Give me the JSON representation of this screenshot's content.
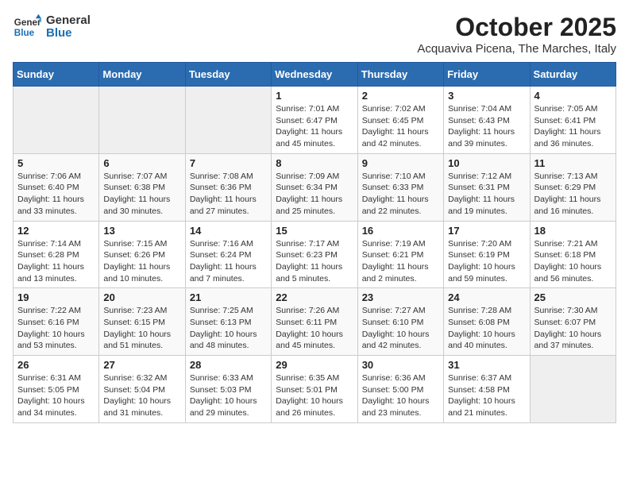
{
  "header": {
    "logo_general": "General",
    "logo_blue": "Blue",
    "month_title": "October 2025",
    "subtitle": "Acquaviva Picena, The Marches, Italy"
  },
  "days_of_week": [
    "Sunday",
    "Monday",
    "Tuesday",
    "Wednesday",
    "Thursday",
    "Friday",
    "Saturday"
  ],
  "weeks": [
    [
      {
        "day": "",
        "info": ""
      },
      {
        "day": "",
        "info": ""
      },
      {
        "day": "",
        "info": ""
      },
      {
        "day": "1",
        "info": "Sunrise: 7:01 AM\nSunset: 6:47 PM\nDaylight: 11 hours and 45 minutes."
      },
      {
        "day": "2",
        "info": "Sunrise: 7:02 AM\nSunset: 6:45 PM\nDaylight: 11 hours and 42 minutes."
      },
      {
        "day": "3",
        "info": "Sunrise: 7:04 AM\nSunset: 6:43 PM\nDaylight: 11 hours and 39 minutes."
      },
      {
        "day": "4",
        "info": "Sunrise: 7:05 AM\nSunset: 6:41 PM\nDaylight: 11 hours and 36 minutes."
      }
    ],
    [
      {
        "day": "5",
        "info": "Sunrise: 7:06 AM\nSunset: 6:40 PM\nDaylight: 11 hours and 33 minutes."
      },
      {
        "day": "6",
        "info": "Sunrise: 7:07 AM\nSunset: 6:38 PM\nDaylight: 11 hours and 30 minutes."
      },
      {
        "day": "7",
        "info": "Sunrise: 7:08 AM\nSunset: 6:36 PM\nDaylight: 11 hours and 27 minutes."
      },
      {
        "day": "8",
        "info": "Sunrise: 7:09 AM\nSunset: 6:34 PM\nDaylight: 11 hours and 25 minutes."
      },
      {
        "day": "9",
        "info": "Sunrise: 7:10 AM\nSunset: 6:33 PM\nDaylight: 11 hours and 22 minutes."
      },
      {
        "day": "10",
        "info": "Sunrise: 7:12 AM\nSunset: 6:31 PM\nDaylight: 11 hours and 19 minutes."
      },
      {
        "day": "11",
        "info": "Sunrise: 7:13 AM\nSunset: 6:29 PM\nDaylight: 11 hours and 16 minutes."
      }
    ],
    [
      {
        "day": "12",
        "info": "Sunrise: 7:14 AM\nSunset: 6:28 PM\nDaylight: 11 hours and 13 minutes."
      },
      {
        "day": "13",
        "info": "Sunrise: 7:15 AM\nSunset: 6:26 PM\nDaylight: 11 hours and 10 minutes."
      },
      {
        "day": "14",
        "info": "Sunrise: 7:16 AM\nSunset: 6:24 PM\nDaylight: 11 hours and 7 minutes."
      },
      {
        "day": "15",
        "info": "Sunrise: 7:17 AM\nSunset: 6:23 PM\nDaylight: 11 hours and 5 minutes."
      },
      {
        "day": "16",
        "info": "Sunrise: 7:19 AM\nSunset: 6:21 PM\nDaylight: 11 hours and 2 minutes."
      },
      {
        "day": "17",
        "info": "Sunrise: 7:20 AM\nSunset: 6:19 PM\nDaylight: 10 hours and 59 minutes."
      },
      {
        "day": "18",
        "info": "Sunrise: 7:21 AM\nSunset: 6:18 PM\nDaylight: 10 hours and 56 minutes."
      }
    ],
    [
      {
        "day": "19",
        "info": "Sunrise: 7:22 AM\nSunset: 6:16 PM\nDaylight: 10 hours and 53 minutes."
      },
      {
        "day": "20",
        "info": "Sunrise: 7:23 AM\nSunset: 6:15 PM\nDaylight: 10 hours and 51 minutes."
      },
      {
        "day": "21",
        "info": "Sunrise: 7:25 AM\nSunset: 6:13 PM\nDaylight: 10 hours and 48 minutes."
      },
      {
        "day": "22",
        "info": "Sunrise: 7:26 AM\nSunset: 6:11 PM\nDaylight: 10 hours and 45 minutes."
      },
      {
        "day": "23",
        "info": "Sunrise: 7:27 AM\nSunset: 6:10 PM\nDaylight: 10 hours and 42 minutes."
      },
      {
        "day": "24",
        "info": "Sunrise: 7:28 AM\nSunset: 6:08 PM\nDaylight: 10 hours and 40 minutes."
      },
      {
        "day": "25",
        "info": "Sunrise: 7:30 AM\nSunset: 6:07 PM\nDaylight: 10 hours and 37 minutes."
      }
    ],
    [
      {
        "day": "26",
        "info": "Sunrise: 6:31 AM\nSunset: 5:05 PM\nDaylight: 10 hours and 34 minutes."
      },
      {
        "day": "27",
        "info": "Sunrise: 6:32 AM\nSunset: 5:04 PM\nDaylight: 10 hours and 31 minutes."
      },
      {
        "day": "28",
        "info": "Sunrise: 6:33 AM\nSunset: 5:03 PM\nDaylight: 10 hours and 29 minutes."
      },
      {
        "day": "29",
        "info": "Sunrise: 6:35 AM\nSunset: 5:01 PM\nDaylight: 10 hours and 26 minutes."
      },
      {
        "day": "30",
        "info": "Sunrise: 6:36 AM\nSunset: 5:00 PM\nDaylight: 10 hours and 23 minutes."
      },
      {
        "day": "31",
        "info": "Sunrise: 6:37 AM\nSunset: 4:58 PM\nDaylight: 10 hours and 21 minutes."
      },
      {
        "day": "",
        "info": ""
      }
    ]
  ]
}
